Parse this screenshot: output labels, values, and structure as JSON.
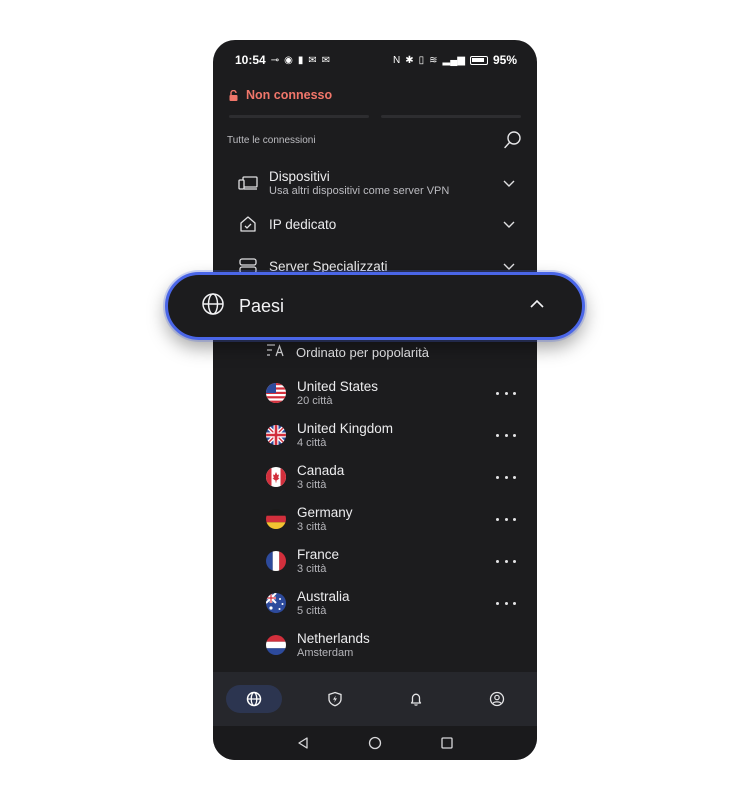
{
  "status_bar": {
    "time": "10:54",
    "battery": "95%"
  },
  "connection": {
    "status": "Non connesso",
    "status_color": "#f0766a"
  },
  "section": {
    "title": "Tutte le connessioni"
  },
  "menu": [
    {
      "label": "Dispositivi",
      "sub": "Usa altri dispositivi come server VPN",
      "icon": "devices-icon"
    },
    {
      "label": "IP dedicato",
      "sub": "",
      "icon": "home-ip-icon"
    },
    {
      "label": "Server Specializzati",
      "sub": "",
      "icon": "server-icon"
    }
  ],
  "paesi": {
    "label": "Paesi",
    "accent": "#4a66e8"
  },
  "sort": {
    "label": "Ordinato per popolarità"
  },
  "countries": [
    {
      "name": "United States",
      "sub": "20 città"
    },
    {
      "name": "United Kingdom",
      "sub": "4 città"
    },
    {
      "name": "Canada",
      "sub": "3 città"
    },
    {
      "name": "Germany",
      "sub": "3 città"
    },
    {
      "name": "France",
      "sub": "3 città"
    },
    {
      "name": "Australia",
      "sub": "5 città"
    },
    {
      "name": "Netherlands",
      "sub": "Amsterdam"
    }
  ],
  "bottom_nav": [
    "globe-icon",
    "shield-bolt-icon",
    "bell-icon",
    "profile-icon"
  ]
}
